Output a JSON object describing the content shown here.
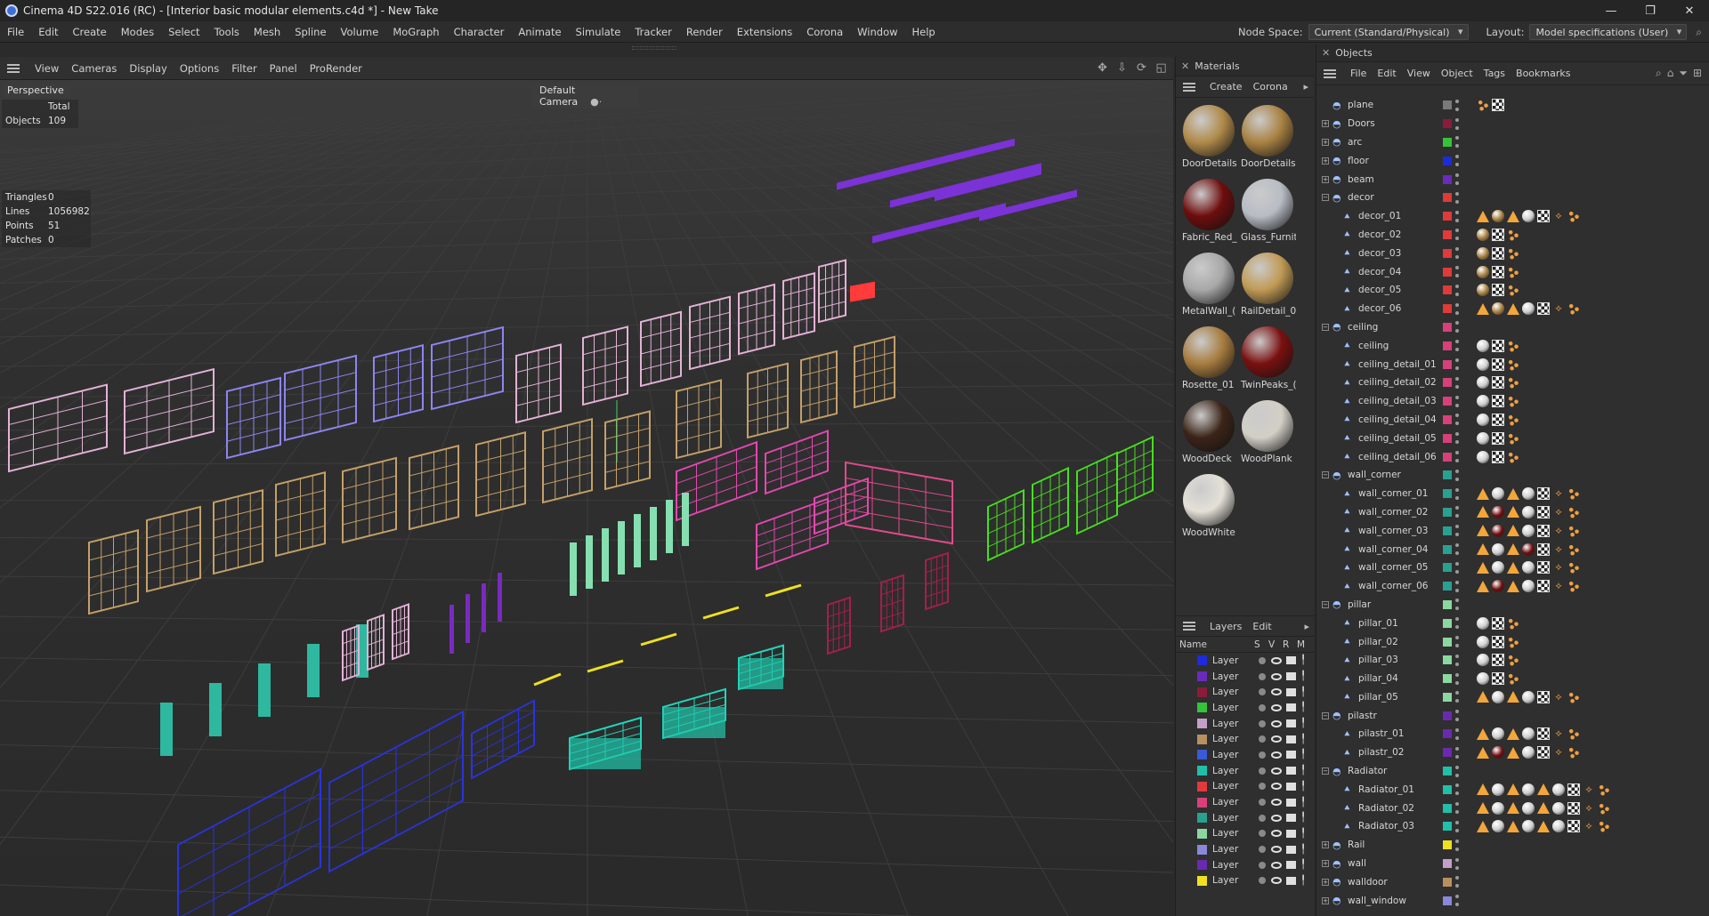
{
  "window": {
    "title": "Cinema 4D S22.016 (RC) - [Interior basic modular elements.c4d *] - New Take",
    "min": "—",
    "max": "❐",
    "close": "✕"
  },
  "menubar": {
    "items": [
      "File",
      "Edit",
      "Create",
      "Modes",
      "Select",
      "Tools",
      "Mesh",
      "Spline",
      "Volume",
      "MoGraph",
      "Character",
      "Animate",
      "Simulate",
      "Tracker",
      "Render",
      "Extensions",
      "Corona",
      "Window",
      "Help"
    ],
    "node_space_label": "Node Space:",
    "node_space_value": "Current (Standard/Physical)",
    "layout_label": "Layout:",
    "layout_value": "Model specifications (User)"
  },
  "viewport": {
    "menu": [
      "View",
      "Cameras",
      "Display",
      "Options",
      "Filter",
      "Panel",
      "ProRender"
    ],
    "view_name": "Perspective",
    "camera": "Default Camera",
    "stats_total": {
      "header": "Total",
      "label": "Objects",
      "value": "109"
    },
    "stats_sel": [
      {
        "label": "Triangles",
        "value": "0"
      },
      {
        "label": "Lines",
        "value": "1056982"
      },
      {
        "label": "Points",
        "value": "51"
      },
      {
        "label": "Patches",
        "value": "0"
      }
    ]
  },
  "materials": {
    "title": "Materials",
    "menu": [
      "Create",
      "Corona"
    ],
    "items": [
      {
        "name": "DoorDetails",
        "color": "#b08a4a"
      },
      {
        "name": "DoorDetails",
        "color": "#a98243"
      },
      {
        "name": "Fabric_Red_",
        "color": "#6e0d0d"
      },
      {
        "name": "Glass_Furnit",
        "color": "#b8bcc4"
      },
      {
        "name": "MetalWall_(",
        "color": "#a8a8a8"
      },
      {
        "name": "RailDetail_0",
        "color": "#c09a55"
      },
      {
        "name": "Rosette_01",
        "color": "#a77c3f"
      },
      {
        "name": "TwinPeaks_(",
        "color": "#7a1010"
      },
      {
        "name": "WoodDeck",
        "color": "#3b2418"
      },
      {
        "name": "WoodPlank",
        "color": "#d2cfc6"
      },
      {
        "name": "WoodWhite",
        "color": "#e4e0d8"
      }
    ]
  },
  "layers": {
    "title": "Layers",
    "menu": [
      "Layers",
      "Edit"
    ],
    "columns": [
      "Name",
      "S",
      "V",
      "R",
      "M"
    ],
    "rows": [
      {
        "name": "Layer",
        "color": "#1e2bd8"
      },
      {
        "name": "Layer",
        "color": "#6a2bbd"
      },
      {
        "name": "Layer",
        "color": "#8a1c3a"
      },
      {
        "name": "Layer",
        "color": "#33c43a"
      },
      {
        "name": "Layer",
        "color": "#c4a0c8"
      },
      {
        "name": "Layer",
        "color": "#b89060"
      },
      {
        "name": "Layer",
        "color": "#3a5ad8"
      },
      {
        "name": "Layer",
        "color": "#20c0a8"
      },
      {
        "name": "Layer",
        "color": "#e03a3a"
      },
      {
        "name": "Layer",
        "color": "#d8407a"
      },
      {
        "name": "Layer",
        "color": "#2aa090"
      },
      {
        "name": "Layer",
        "color": "#8ad8a0"
      },
      {
        "name": "Layer",
        "color": "#8a88d8"
      },
      {
        "name": "Layer",
        "color": "#6a2ab0"
      },
      {
        "name": "Layer",
        "color": "#f0e020"
      }
    ]
  },
  "objects": {
    "title": "Objects",
    "menu": [
      "File",
      "Edit",
      "View",
      "Object",
      "Tags",
      "Bookmarks"
    ],
    "rows": [
      {
        "name": "plane",
        "indent": 0,
        "exp": "",
        "color": "#7a7a7a",
        "tags": [
          "dots",
          "chk"
        ]
      },
      {
        "name": "Doors",
        "indent": 0,
        "exp": "+",
        "color": "#8a1c3a",
        "tags": []
      },
      {
        "name": "arc",
        "indent": 0,
        "exp": "+",
        "color": "#33c43a",
        "tags": []
      },
      {
        "name": "floor",
        "indent": 0,
        "exp": "+",
        "color": "#1e2bd8",
        "tags": []
      },
      {
        "name": "beam",
        "indent": 0,
        "exp": "+",
        "color": "#6a2bbd",
        "tags": []
      },
      {
        "name": "decor",
        "indent": 0,
        "exp": "−",
        "color": "#e03a3a",
        "tags": []
      },
      {
        "name": "decor_01",
        "indent": 1,
        "exp": "",
        "color": "#e03a3a",
        "tags": [
          "cone",
          "sph-gold",
          "cone",
          "sph-white",
          "chk",
          "wave",
          "dots"
        ]
      },
      {
        "name": "decor_02",
        "indent": 1,
        "exp": "",
        "color": "#e03a3a",
        "tags": [
          "sph-gold",
          "chk",
          "dots"
        ]
      },
      {
        "name": "decor_03",
        "indent": 1,
        "exp": "",
        "color": "#e03a3a",
        "tags": [
          "sph-gold",
          "chk",
          "dots"
        ]
      },
      {
        "name": "decor_04",
        "indent": 1,
        "exp": "",
        "color": "#e03a3a",
        "tags": [
          "sph-gold",
          "chk",
          "dots"
        ]
      },
      {
        "name": "decor_05",
        "indent": 1,
        "exp": "",
        "color": "#e03a3a",
        "tags": [
          "sph-gold",
          "chk",
          "dots"
        ]
      },
      {
        "name": "decor_06",
        "indent": 1,
        "exp": "",
        "color": "#e03a3a",
        "tags": [
          "cone",
          "sph-gold",
          "cone",
          "sph-white",
          "chk",
          "wave",
          "dots"
        ]
      },
      {
        "name": "ceiling",
        "indent": 0,
        "exp": "−",
        "color": "#d8407a",
        "tags": []
      },
      {
        "name": "ceiling",
        "indent": 1,
        "exp": "",
        "color": "#d8407a",
        "tags": [
          "sph-white",
          "chk",
          "dots"
        ]
      },
      {
        "name": "ceiling_detail_01",
        "indent": 1,
        "exp": "",
        "color": "#d8407a",
        "tags": [
          "sph-white",
          "chk",
          "dots"
        ]
      },
      {
        "name": "ceiling_detail_02",
        "indent": 1,
        "exp": "",
        "color": "#d8407a",
        "tags": [
          "sph-white",
          "chk",
          "dots"
        ]
      },
      {
        "name": "ceiling_detail_03",
        "indent": 1,
        "exp": "",
        "color": "#d8407a",
        "tags": [
          "sph-white",
          "chk",
          "dots"
        ]
      },
      {
        "name": "ceiling_detail_04",
        "indent": 1,
        "exp": "",
        "color": "#d8407a",
        "tags": [
          "sph-white",
          "chk",
          "dots"
        ]
      },
      {
        "name": "ceiling_detail_05",
        "indent": 1,
        "exp": "",
        "color": "#d8407a",
        "tags": [
          "sph-white",
          "chk",
          "dots"
        ]
      },
      {
        "name": "ceiling_detail_06",
        "indent": 1,
        "exp": "",
        "color": "#d8407a",
        "tags": [
          "sph-white",
          "chk",
          "dots"
        ]
      },
      {
        "name": "wall_corner",
        "indent": 0,
        "exp": "−",
        "color": "#2aa090",
        "tags": []
      },
      {
        "name": "wall_corner_01",
        "indent": 1,
        "exp": "",
        "color": "#2aa090",
        "tags": [
          "cone",
          "sph-white",
          "cone",
          "sph-white",
          "chk",
          "wave",
          "dots"
        ]
      },
      {
        "name": "wall_corner_02",
        "indent": 1,
        "exp": "",
        "color": "#2aa090",
        "tags": [
          "cone",
          "sph-red",
          "cone",
          "sph-white",
          "chk",
          "wave",
          "dots"
        ]
      },
      {
        "name": "wall_corner_03",
        "indent": 1,
        "exp": "",
        "color": "#2aa090",
        "tags": [
          "cone",
          "sph-red",
          "cone",
          "sph-white",
          "chk",
          "wave",
          "dots"
        ]
      },
      {
        "name": "wall_corner_04",
        "indent": 1,
        "exp": "",
        "color": "#2aa090",
        "tags": [
          "cone",
          "sph-white",
          "cone",
          "sph-red",
          "chk",
          "wave",
          "dots"
        ]
      },
      {
        "name": "wall_corner_05",
        "indent": 1,
        "exp": "",
        "color": "#2aa090",
        "tags": [
          "cone",
          "sph-white",
          "cone",
          "sph-white",
          "chk",
          "wave",
          "dots"
        ]
      },
      {
        "name": "wall_corner_06",
        "indent": 1,
        "exp": "",
        "color": "#2aa090",
        "tags": [
          "cone",
          "sph-red",
          "cone",
          "sph-white",
          "chk",
          "wave",
          "dots"
        ]
      },
      {
        "name": "pillar",
        "indent": 0,
        "exp": "−",
        "color": "#8ad8a0",
        "tags": []
      },
      {
        "name": "pillar_01",
        "indent": 1,
        "exp": "",
        "color": "#8ad8a0",
        "tags": [
          "sph-white",
          "chk",
          "dots"
        ]
      },
      {
        "name": "pillar_02",
        "indent": 1,
        "exp": "",
        "color": "#8ad8a0",
        "tags": [
          "sph-white",
          "chk",
          "dots"
        ]
      },
      {
        "name": "pillar_03",
        "indent": 1,
        "exp": "",
        "color": "#8ad8a0",
        "tags": [
          "sph-white",
          "chk",
          "dots"
        ]
      },
      {
        "name": "pillar_04",
        "indent": 1,
        "exp": "",
        "color": "#8ad8a0",
        "tags": [
          "sph-white",
          "chk",
          "dots"
        ]
      },
      {
        "name": "pillar_05",
        "indent": 1,
        "exp": "",
        "color": "#8ad8a0",
        "tags": [
          "cone",
          "sph-white",
          "cone",
          "sph-white",
          "chk",
          "wave",
          "dots"
        ]
      },
      {
        "name": "pilastr",
        "indent": 0,
        "exp": "−",
        "color": "#6a2ab0",
        "tags": []
      },
      {
        "name": "pilastr_01",
        "indent": 1,
        "exp": "",
        "color": "#6a2ab0",
        "tags": [
          "cone",
          "sph-white",
          "cone",
          "sph-white",
          "chk",
          "wave",
          "dots"
        ]
      },
      {
        "name": "pilastr_02",
        "indent": 1,
        "exp": "",
        "color": "#6a2ab0",
        "tags": [
          "cone",
          "sph-red",
          "cone",
          "sph-white",
          "chk",
          "wave",
          "dots"
        ]
      },
      {
        "name": "Radiator",
        "indent": 0,
        "exp": "−",
        "color": "#20c0a8",
        "tags": []
      },
      {
        "name": "Radiator_01",
        "indent": 1,
        "exp": "",
        "color": "#20c0a8",
        "tags": [
          "cone",
          "sph-white",
          "cone",
          "sph-white",
          "cone",
          "sph-white",
          "chk",
          "wave",
          "dots"
        ]
      },
      {
        "name": "Radiator_02",
        "indent": 1,
        "exp": "",
        "color": "#20c0a8",
        "tags": [
          "cone",
          "sph-white",
          "cone",
          "sph-white",
          "cone",
          "sph-white",
          "chk",
          "wave",
          "dots"
        ]
      },
      {
        "name": "Radiator_03",
        "indent": 1,
        "exp": "",
        "color": "#20c0a8",
        "tags": [
          "cone",
          "sph-white",
          "cone",
          "sph-white",
          "cone",
          "sph-white",
          "chk",
          "wave",
          "dots"
        ]
      },
      {
        "name": "Rail",
        "indent": 0,
        "exp": "+",
        "color": "#f0e020",
        "tags": []
      },
      {
        "name": "wall",
        "indent": 0,
        "exp": "+",
        "color": "#c4a0c8",
        "tags": []
      },
      {
        "name": "walldoor",
        "indent": 0,
        "exp": "+",
        "color": "#b89060",
        "tags": []
      },
      {
        "name": "wall_window",
        "indent": 0,
        "exp": "+",
        "color": "#8a88d8",
        "tags": []
      }
    ]
  }
}
